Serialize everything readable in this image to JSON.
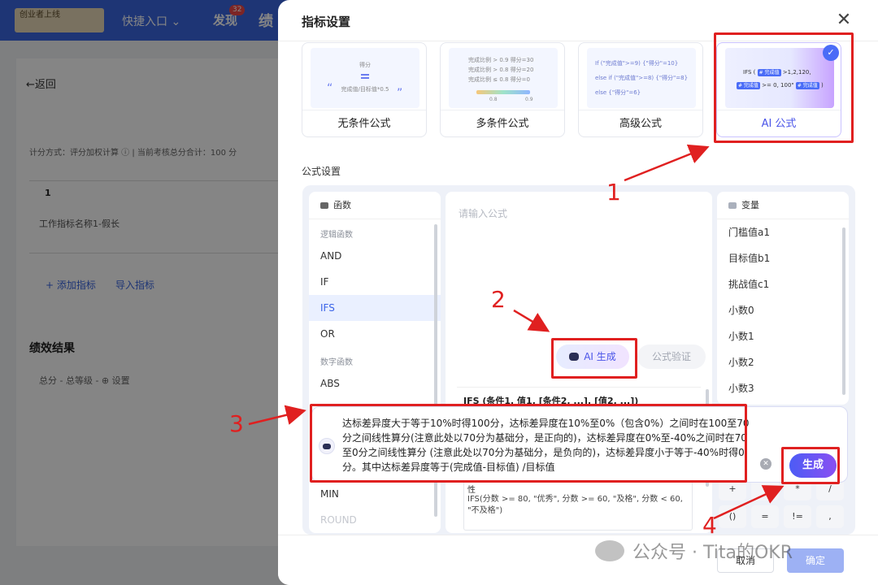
{
  "background": {
    "logo_text": "创业者上线",
    "quick_entry": "快捷入口",
    "discover": "发现",
    "discover_badge": "32",
    "perf_tab": "绩",
    "back": "←返回",
    "scoring": "计分方式：评分加权计算 ⓘ  |  当前考核总分合计：100 分",
    "row_index": "1",
    "indicator_name": "工作指标名称1-假长",
    "add_indicator": "+ 添加指标",
    "import_indicator": "导入指标",
    "result_title": "绩效结果",
    "total": "总分  -          总等级  -        ⊕ 设置"
  },
  "dialog": {
    "title": "指标设置",
    "close_label": "✕",
    "cards": [
      {
        "label": "无条件公式"
      },
      {
        "label": "多条件公式"
      },
      {
        "label": "高级公式"
      },
      {
        "label": "AI 公式",
        "selected": true
      }
    ],
    "card_previews": {
      "no_cond_top": "得分",
      "no_cond_formula": "完成值/目标值*0.5",
      "multi_lines": [
        "完成比例 > 0.9    得分=30",
        "完成比例 > 0.8    得分=20",
        "完成比例 ≤ 0.8    得分=0"
      ],
      "multi_ticks": [
        "0.8",
        "0.9"
      ],
      "adv_lines": [
        "If (\"完成值\">=9) {\"得分\"=10}",
        "else if (\"完成值\">=8) {\"得分\"=8}",
        "else {\"得分\"=6}"
      ],
      "ai_line1_prefix": "IFS (",
      "ai_chip1": "# 完成值",
      "ai_line1_suffix": ">1,2,120,",
      "ai_chip2": "# 完成值",
      "ai_line2_mid": ">= 0, 100\"",
      "ai_chip3": "# 完成值",
      "ai_line2_end": ")"
    },
    "section_title": "公式设置",
    "functions": {
      "header": "函数",
      "group_logic": "逻辑函数",
      "logic_items": [
        "AND",
        "IF",
        "IFS",
        "OR"
      ],
      "active": "IFS",
      "group_math": "数字函数",
      "math_items": [
        "ABS"
      ],
      "lower_items": [
        "MIN",
        "ROUND"
      ]
    },
    "editor": {
      "placeholder": "请输入公式",
      "ai_generate": "AI 生成",
      "verify": "公式验证",
      "doc_signature": "IFS (条件1, 值1, [条件2, ...], [值2, ...])",
      "doc_tail": "性",
      "doc_example": "IFS(分数 >= 80, \"优秀\", 分数 >= 60, \"及格\", 分数 < 60, \"不及格\")"
    },
    "variables": {
      "header": "变量",
      "items": [
        "门槛值a1",
        "目标值b1",
        "挑战值c1",
        "小数0",
        "小数1",
        "小数2",
        "小数3"
      ]
    },
    "operators": [
      "+",
      "-",
      "*",
      "/",
      "()",
      "=",
      "!=",
      ","
    ],
    "ai_prompt": {
      "text": "达标差异度大于等于10%时得100分，达标差异度在10%至0%（包含0%）之间时在100至70分之间线性算分(注意此处以70分为基础分，是正向的)，达标差异度在0%至-40%之间时在70至0分之间线性算分 (注意此处以70分为基础分，是负向的)，达标差异度小于等于-40%时得0分。其中达标差异度等于(完成值-目标值) /目标值",
      "generate": "生成"
    },
    "footer": {
      "cancel": "取消",
      "ok": "确定"
    }
  },
  "annotations": [
    "1",
    "2",
    "3",
    "4"
  ],
  "watermark": "公众号 · Tita的OKR",
  "colors": {
    "accent": "#4a6cf7",
    "annotation": "#e02020",
    "active_bg": "#eaf0ff"
  }
}
